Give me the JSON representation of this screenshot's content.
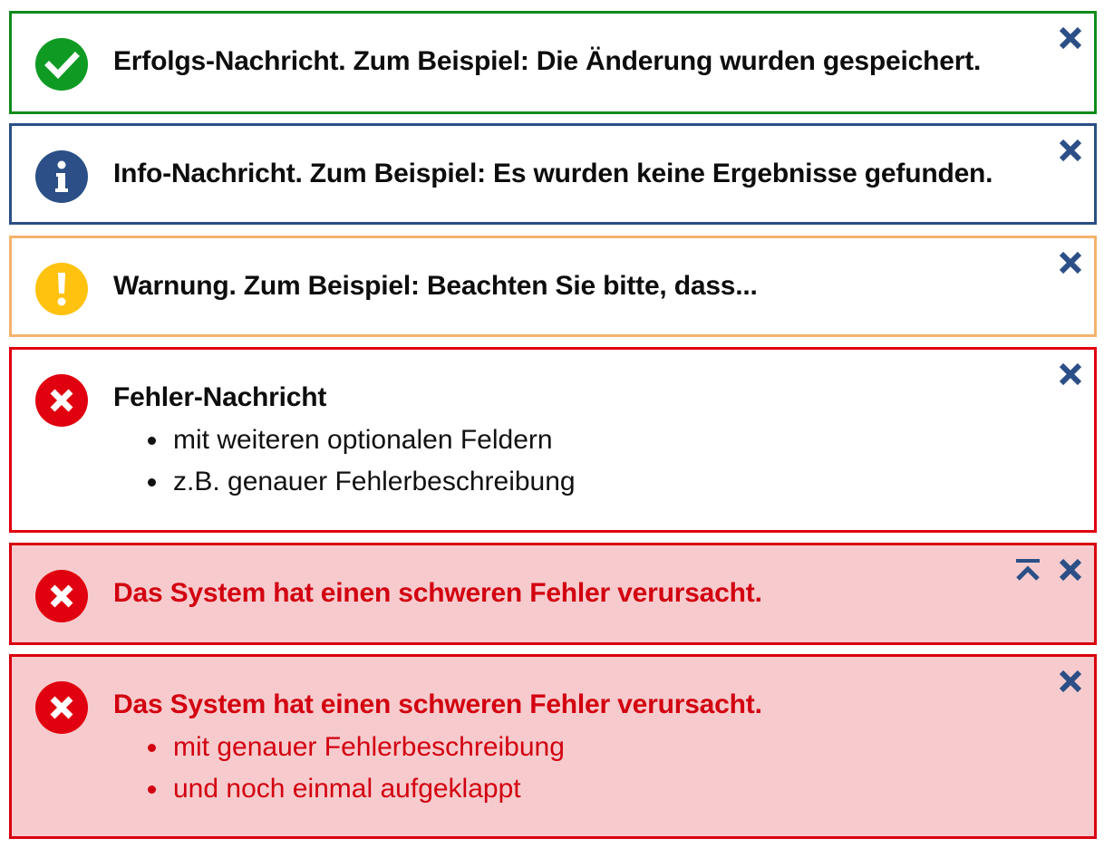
{
  "colors": {
    "success": "#0f8c1a",
    "info": "#2b4f86",
    "warning": "#ffc20e",
    "warning_border": "#f3b36c",
    "error": "#e0000f",
    "error_background": "#f7cbcd",
    "control_icon": "#2b4f86"
  },
  "messages": [
    {
      "type": "success",
      "icon": "checkmark-circle-icon",
      "title": "Erfolgs-Nachricht. Zum Beispiel: Die Änderung wurden gespeichert.",
      "controls": [
        "close-icon"
      ]
    },
    {
      "type": "info",
      "icon": "info-circle-icon",
      "title": "Info-Nachricht. Zum Beispiel: Es wurden keine Ergebnisse gefunden.",
      "controls": [
        "close-icon"
      ]
    },
    {
      "type": "warning",
      "icon": "exclamation-circle-icon",
      "title": "Warnung. Zum Beispiel: Beachten Sie bitte, dass...",
      "controls": [
        "close-icon"
      ]
    },
    {
      "type": "error",
      "icon": "error-x-circle-icon",
      "title": "Fehler-Nachricht",
      "details": [
        "mit weiteren optionalen Feldern",
        "z.B. genauer Fehlerbeschreibung"
      ],
      "controls": [
        "close-icon"
      ]
    },
    {
      "type": "fatal",
      "icon": "error-x-circle-icon",
      "title": "Das System hat einen schweren Fehler verursacht.",
      "controls": [
        "expand-toggle-icon",
        "close-icon"
      ]
    },
    {
      "type": "fatal",
      "icon": "error-x-circle-icon",
      "title": "Das System hat einen schweren Fehler verursacht.",
      "details": [
        "mit genauer Fehlerbeschreibung",
        "und noch einmal aufgeklappt"
      ],
      "controls": [
        "close-icon"
      ]
    }
  ]
}
